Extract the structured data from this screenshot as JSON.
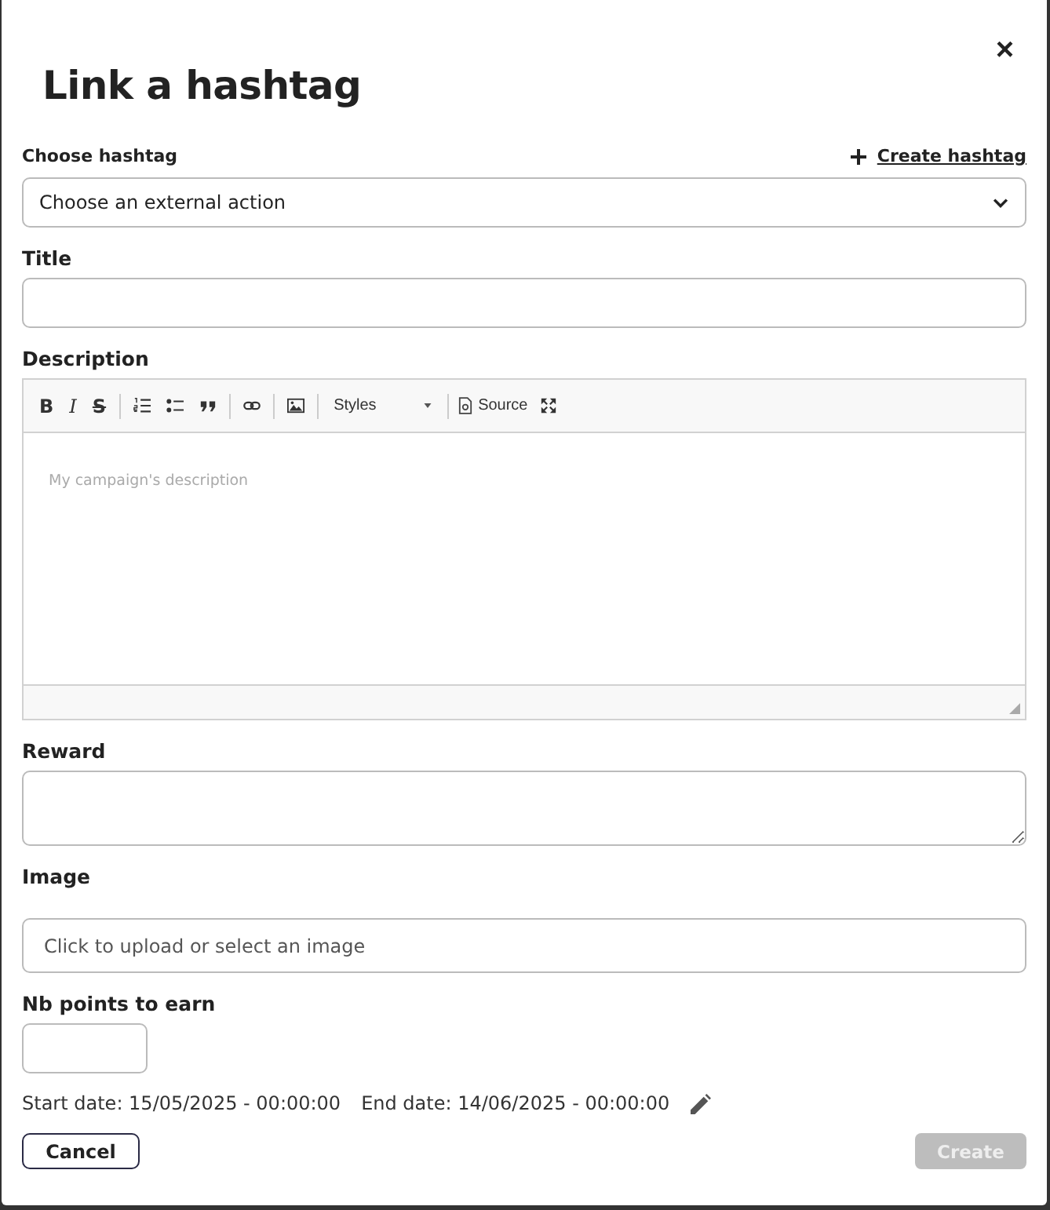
{
  "dialog": {
    "title": "Link a hashtag",
    "close": "×"
  },
  "hashtag": {
    "label": "Choose hashtag",
    "create_link": "Create hashtag",
    "select_value": "Choose an external action"
  },
  "title_field": {
    "label": "Title"
  },
  "description": {
    "label": "Description",
    "toolbar": [
      {
        "kind": "bold",
        "text": "B"
      },
      {
        "kind": "italic",
        "text": "I"
      },
      {
        "kind": "strike",
        "text": "S"
      },
      {
        "kind": "separator"
      },
      {
        "kind": "numbered"
      },
      {
        "kind": "bullets"
      },
      {
        "kind": "quote"
      },
      {
        "kind": "separator"
      },
      {
        "kind": "link"
      },
      {
        "kind": "separator"
      },
      {
        "kind": "image"
      },
      {
        "kind": "separator"
      },
      {
        "kind": "dropdown",
        "text": "Styles"
      },
      {
        "kind": "separator"
      },
      {
        "kind": "source",
        "text": "Source"
      },
      {
        "kind": "maximize"
      }
    ],
    "placeholder": "My campaign's description"
  },
  "reward": {
    "label": "Reward"
  },
  "image": {
    "label": "Image",
    "placeholder": "Click to upload or select an image"
  },
  "points": {
    "label": "Nb points to earn"
  },
  "dates": {
    "start": "Start date: 15/05/2025 - 00:00:00",
    "end": "End date: 14/06/2025 - 00:00:00"
  },
  "buttons": {
    "cancel": {
      "label": "Cancel",
      "disabled": false
    },
    "create": {
      "label": "Create",
      "disabled": true
    }
  }
}
